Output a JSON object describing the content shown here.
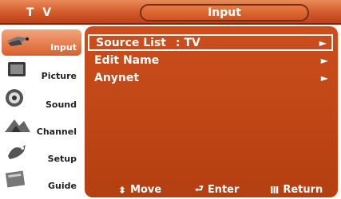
{
  "header": {
    "tv_label": "T V",
    "title": "Input"
  },
  "sidebar": {
    "items": [
      {
        "label": "Input",
        "icon": "input-icon",
        "active": true
      },
      {
        "label": "Picture",
        "icon": "picture-icon",
        "active": false
      },
      {
        "label": "Sound",
        "icon": "sound-icon",
        "active": false
      },
      {
        "label": "Channel",
        "icon": "channel-icon",
        "active": false
      },
      {
        "label": "Setup",
        "icon": "setup-icon",
        "active": false
      },
      {
        "label": "Guide",
        "icon": "guide-icon",
        "active": false
      }
    ]
  },
  "menu": {
    "rows": [
      {
        "label": "Source List",
        "value": ": TV",
        "arrow": "►",
        "selected": true
      },
      {
        "label": "Edit Name",
        "value": "",
        "arrow": "►",
        "selected": false
      },
      {
        "label": "Anynet",
        "value": "",
        "arrow": "►",
        "selected": false
      }
    ]
  },
  "footer": {
    "move": {
      "icon": "⬍",
      "label": "Move"
    },
    "enter": {
      "icon": "⮐",
      "label": "Enter"
    },
    "return": {
      "icon": "Ⅲ",
      "label": "Return"
    }
  },
  "colors": {
    "accent": "#c4481a",
    "header": "#d2592a",
    "active_item": "#e47a4a"
  }
}
